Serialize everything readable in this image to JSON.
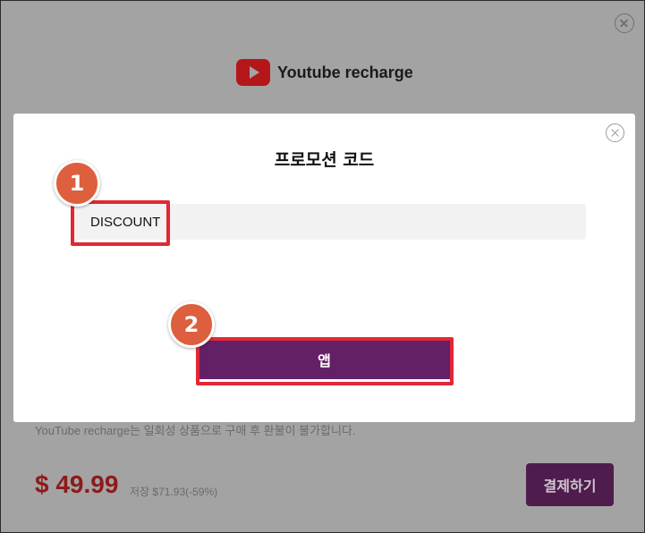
{
  "background": {
    "title": "Youtube recharge",
    "notice": "YouTube recharge는 일회성 상품으로 구매 후 환불이 불가합니다.",
    "price": "$ 49.99",
    "savings": "저장 $71.93(-59%)",
    "pay_label": "결제하기",
    "icons": {
      "logo": "youtube-logo-icon",
      "close": "close-circle-icon"
    }
  },
  "modal": {
    "title": "프로모션 코드",
    "promo_value": "DISCOUNT",
    "apply_label": "앱",
    "icons": {
      "close": "close-circle-icon"
    }
  },
  "annotations": {
    "step1": "1",
    "step2": "2"
  },
  "colors": {
    "accent": "#642066",
    "price": "#8e1a1a",
    "highlight": "#e32734",
    "badge": "#dd5f3d"
  }
}
